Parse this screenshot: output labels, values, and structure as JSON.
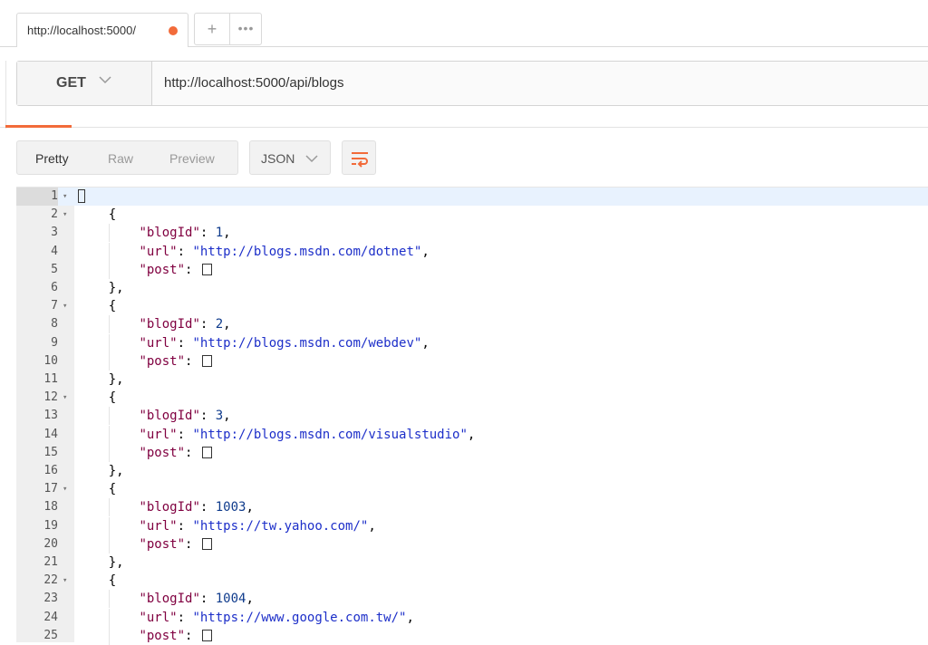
{
  "tabs": [
    {
      "label": "http://localhost:5000/",
      "unsaved": true
    }
  ],
  "tab_actions": {
    "new_tab_icon": "plus-icon",
    "new_tab_glyph": "+",
    "more_icon": "more-icon",
    "more_glyph": "•••"
  },
  "request": {
    "method": "GET",
    "url": "http://localhost:5000/api/blogs"
  },
  "response_view": {
    "options": [
      "Pretty",
      "Raw",
      "Preview"
    ],
    "active_option": "Pretty",
    "format": "JSON",
    "wrap_icon": "wrap-lines-icon"
  },
  "colors": {
    "accent": "#f26b3a",
    "json_key": "#800040",
    "json_string": "#1d2fc9",
    "json_number": "#0f3b8c"
  },
  "code_lines": [
    {
      "n": "1",
      "fold": true,
      "indent": 0,
      "parts": [
        {
          "t": "[",
          "c": "p"
        }
      ]
    },
    {
      "n": "2",
      "fold": true,
      "indent": 1,
      "parts": [
        {
          "t": "{",
          "c": "p"
        }
      ]
    },
    {
      "n": "3",
      "fold": false,
      "indent": 2,
      "parts": [
        {
          "t": "\"blogId\"",
          "c": "k"
        },
        {
          "t": ": ",
          "c": "p"
        },
        {
          "t": "1",
          "c": "n"
        },
        {
          "t": ",",
          "c": "p"
        }
      ]
    },
    {
      "n": "4",
      "fold": false,
      "indent": 2,
      "parts": [
        {
          "t": "\"url\"",
          "c": "k"
        },
        {
          "t": ": ",
          "c": "p"
        },
        {
          "t": "\"http://blogs.msdn.com/dotnet\"",
          "c": "s"
        },
        {
          "t": ",",
          "c": "p"
        }
      ]
    },
    {
      "n": "5",
      "fold": false,
      "indent": 2,
      "parts": [
        {
          "t": "\"post\"",
          "c": "k"
        },
        {
          "t": ": ",
          "c": "p"
        },
        {
          "t": "[]",
          "c": "arr"
        }
      ]
    },
    {
      "n": "6",
      "fold": false,
      "indent": 1,
      "parts": [
        {
          "t": "},",
          "c": "p"
        }
      ]
    },
    {
      "n": "7",
      "fold": true,
      "indent": 1,
      "parts": [
        {
          "t": "{",
          "c": "p"
        }
      ]
    },
    {
      "n": "8",
      "fold": false,
      "indent": 2,
      "parts": [
        {
          "t": "\"blogId\"",
          "c": "k"
        },
        {
          "t": ": ",
          "c": "p"
        },
        {
          "t": "2",
          "c": "n"
        },
        {
          "t": ",",
          "c": "p"
        }
      ]
    },
    {
      "n": "9",
      "fold": false,
      "indent": 2,
      "parts": [
        {
          "t": "\"url\"",
          "c": "k"
        },
        {
          "t": ": ",
          "c": "p"
        },
        {
          "t": "\"http://blogs.msdn.com/webdev\"",
          "c": "s"
        },
        {
          "t": ",",
          "c": "p"
        }
      ]
    },
    {
      "n": "10",
      "fold": false,
      "indent": 2,
      "parts": [
        {
          "t": "\"post\"",
          "c": "k"
        },
        {
          "t": ": ",
          "c": "p"
        },
        {
          "t": "[]",
          "c": "arr"
        }
      ]
    },
    {
      "n": "11",
      "fold": false,
      "indent": 1,
      "parts": [
        {
          "t": "},",
          "c": "p"
        }
      ]
    },
    {
      "n": "12",
      "fold": true,
      "indent": 1,
      "parts": [
        {
          "t": "{",
          "c": "p"
        }
      ]
    },
    {
      "n": "13",
      "fold": false,
      "indent": 2,
      "parts": [
        {
          "t": "\"blogId\"",
          "c": "k"
        },
        {
          "t": ": ",
          "c": "p"
        },
        {
          "t": "3",
          "c": "n"
        },
        {
          "t": ",",
          "c": "p"
        }
      ]
    },
    {
      "n": "14",
      "fold": false,
      "indent": 2,
      "parts": [
        {
          "t": "\"url\"",
          "c": "k"
        },
        {
          "t": ": ",
          "c": "p"
        },
        {
          "t": "\"http://blogs.msdn.com/visualstudio\"",
          "c": "s"
        },
        {
          "t": ",",
          "c": "p"
        }
      ]
    },
    {
      "n": "15",
      "fold": false,
      "indent": 2,
      "parts": [
        {
          "t": "\"post\"",
          "c": "k"
        },
        {
          "t": ": ",
          "c": "p"
        },
        {
          "t": "[]",
          "c": "arr"
        }
      ]
    },
    {
      "n": "16",
      "fold": false,
      "indent": 1,
      "parts": [
        {
          "t": "},",
          "c": "p"
        }
      ]
    },
    {
      "n": "17",
      "fold": true,
      "indent": 1,
      "parts": [
        {
          "t": "{",
          "c": "p"
        }
      ]
    },
    {
      "n": "18",
      "fold": false,
      "indent": 2,
      "parts": [
        {
          "t": "\"blogId\"",
          "c": "k"
        },
        {
          "t": ": ",
          "c": "p"
        },
        {
          "t": "1003",
          "c": "n"
        },
        {
          "t": ",",
          "c": "p"
        }
      ]
    },
    {
      "n": "19",
      "fold": false,
      "indent": 2,
      "parts": [
        {
          "t": "\"url\"",
          "c": "k"
        },
        {
          "t": ": ",
          "c": "p"
        },
        {
          "t": "\"https://tw.yahoo.com/\"",
          "c": "s"
        },
        {
          "t": ",",
          "c": "p"
        }
      ]
    },
    {
      "n": "20",
      "fold": false,
      "indent": 2,
      "parts": [
        {
          "t": "\"post\"",
          "c": "k"
        },
        {
          "t": ": ",
          "c": "p"
        },
        {
          "t": "[]",
          "c": "arr"
        }
      ]
    },
    {
      "n": "21",
      "fold": false,
      "indent": 1,
      "parts": [
        {
          "t": "},",
          "c": "p"
        }
      ]
    },
    {
      "n": "22",
      "fold": true,
      "indent": 1,
      "parts": [
        {
          "t": "{",
          "c": "p"
        }
      ]
    },
    {
      "n": "23",
      "fold": false,
      "indent": 2,
      "parts": [
        {
          "t": "\"blogId\"",
          "c": "k"
        },
        {
          "t": ": ",
          "c": "p"
        },
        {
          "t": "1004",
          "c": "n"
        },
        {
          "t": ",",
          "c": "p"
        }
      ]
    },
    {
      "n": "24",
      "fold": false,
      "indent": 2,
      "parts": [
        {
          "t": "\"url\"",
          "c": "k"
        },
        {
          "t": ": ",
          "c": "p"
        },
        {
          "t": "\"https://www.google.com.tw/\"",
          "c": "s"
        },
        {
          "t": ",",
          "c": "p"
        }
      ]
    },
    {
      "n": "25",
      "fold": false,
      "indent": 2,
      "parts": [
        {
          "t": "\"post\"",
          "c": "k"
        },
        {
          "t": ": ",
          "c": "p"
        },
        {
          "t": "[]",
          "c": "arr"
        }
      ]
    }
  ]
}
